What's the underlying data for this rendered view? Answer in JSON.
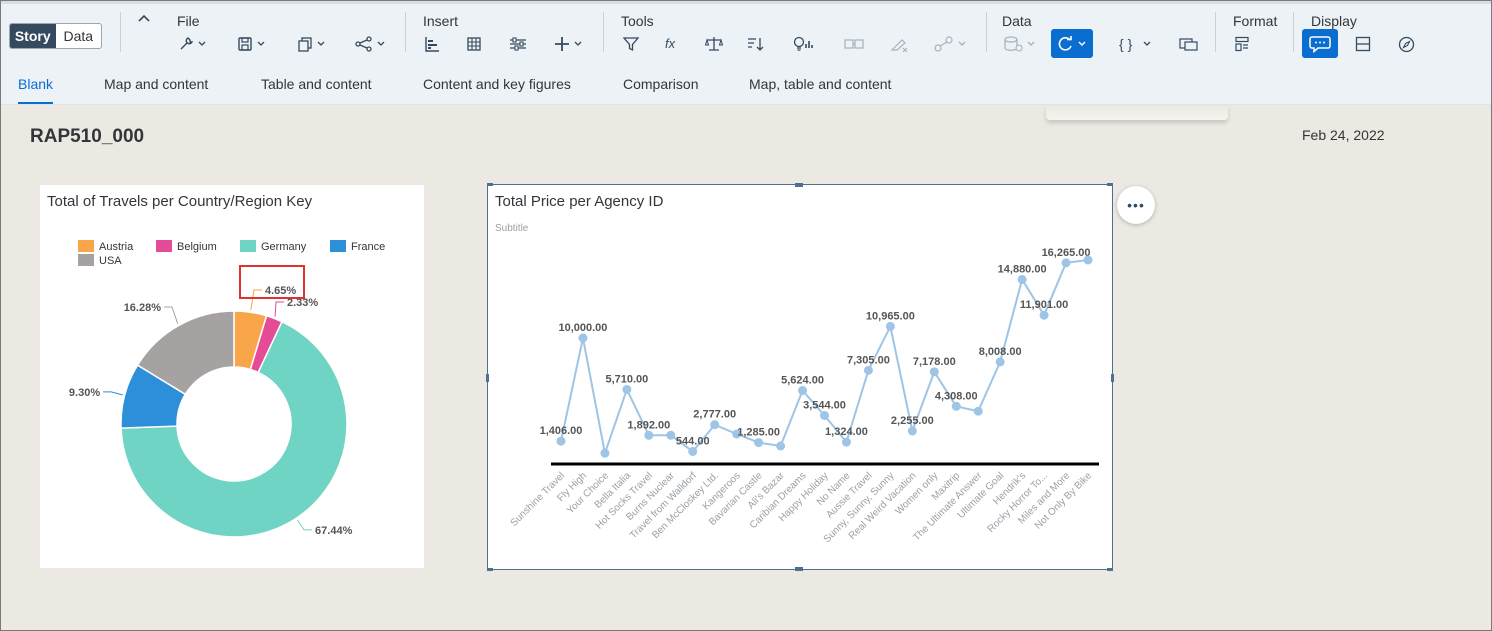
{
  "mode_switch": {
    "story": "Story",
    "data": "Data"
  },
  "toolbar": {
    "groups": {
      "file": "File",
      "insert": "Insert",
      "tools": "Tools",
      "data": "Data",
      "format": "Format",
      "display": "Display"
    }
  },
  "templates": [
    "Blank",
    "Map and content",
    "Table and content",
    "Content and key figures",
    "Comparison",
    "Map, table and content"
  ],
  "page": {
    "title": "RAP510_000",
    "date": "Feb 24, 2022"
  },
  "more_button": "•••",
  "colors": {
    "austria": "#f9a549",
    "belgium": "#e54b97",
    "germany": "#6fd4c3",
    "france": "#2d8fd9",
    "usa": "#a7a2a2",
    "line": "#9ec4e6",
    "accent": "#0a6ed1",
    "highlight": "#e03232"
  },
  "chart_data": [
    {
      "type": "pie",
      "title": "Total of Travels per Country/Region Key",
      "legend": [
        "Austria",
        "Belgium",
        "Germany",
        "France",
        "USA"
      ],
      "legend_position": "top",
      "slices": [
        {
          "name": "Austria",
          "value": 4.65,
          "label": "4.65%"
        },
        {
          "name": "Belgium",
          "value": 2.33,
          "label": "2.33%"
        },
        {
          "name": "Germany",
          "value": 67.44,
          "label": "67.44%"
        },
        {
          "name": "France",
          "value": 9.3,
          "label": "9.30%"
        },
        {
          "name": "USA",
          "value": 16.28,
          "label": "16.28%"
        }
      ]
    },
    {
      "type": "line",
      "title": "Total Price per Agency ID",
      "subtitle": "Subtitle",
      "categories": [
        "Sunshine Travel",
        "Fly High",
        "Your Choice",
        "Bella Italia",
        "Hot Socks Travel",
        "Burns Nuclear",
        "Travel from Walldorf",
        "Ben McCloskey Ltd.",
        "Kangeroos",
        "Bavarian Castle",
        "Ali's Bazar",
        "Caribian Dreams",
        "Happy Holiday",
        "No Name",
        "Aussie Travel",
        "Sunny, Sunny, Sunny",
        "Real Weird Vacation",
        "Women only",
        "Maxitrip",
        "The Ultimate Answer",
        "Ultimate Goal",
        "Hendrik's",
        "Rocky Horror To...",
        "Miles and More",
        "Not Only By Bike"
      ],
      "values": [
        1406,
        10000,
        400,
        5710,
        1892,
        1900,
        544,
        2777,
        2000,
        1285,
        1000,
        5624,
        3544,
        1324,
        7305,
        10965,
        2255,
        7178,
        4308,
        3900,
        8008,
        14880,
        11901,
        16265,
        16500
      ],
      "data_labels": [
        "1,406.00",
        "10,000.00",
        "",
        "5,710.00",
        "1,892.00",
        "",
        "544.00",
        "2,777.00",
        "",
        "1,285.00",
        "",
        "5,624.00",
        "3,544.00",
        "1,324.00",
        "7,305.00",
        "10,965.00",
        "2,255.00",
        "7,178.00",
        "4,308.00",
        "",
        "8,008.00",
        "14,880.00",
        "11,901.00",
        "16,265.00",
        ""
      ]
    }
  ]
}
